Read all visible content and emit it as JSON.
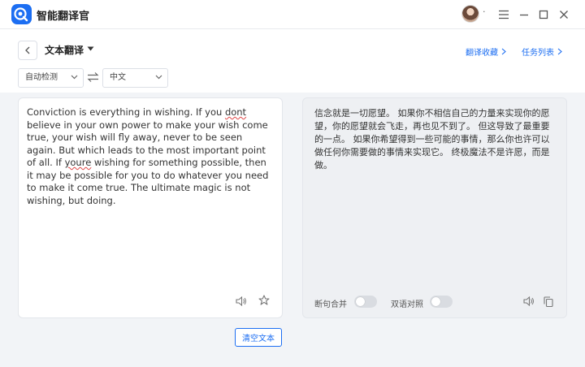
{
  "app": {
    "title": "智能翻译官"
  },
  "header": {
    "user_more": "·"
  },
  "toolbar": {
    "mode_label": "文本翻译",
    "favorites_link": "翻译收藏",
    "tasks_link": "任务列表",
    "source_language": "自动检测",
    "target_language": "中文"
  },
  "source": {
    "segments": [
      "Conviction is everything in wishing. If you ",
      "dont",
      " believe in your own power to make your wish come true, your wish will fly away, never to be seen again. But which leads to the most important point of all. If ",
      "youre",
      " wishing for something possible, then it may be possible for you to do whatever you need to make it come true. The ultimate magic is not wishing, but doing."
    ]
  },
  "result": {
    "text": "信念就是一切愿望。 如果你不相信自己的力量来实现你的愿望，你的愿望就会飞走，再也见不到了。 但这导致了最重要的一点。 如果你希望得到一些可能的事情，那么你也许可以做任何你需要做的事情来实现它。 终极魔法不是许愿，而是做。",
    "toggle_sentence_merge": "断句合并",
    "toggle_bilingual": "双语对照",
    "toggle_sentence_merge_on": false,
    "toggle_bilingual_on": false
  },
  "actions": {
    "clear_label": "清空文本"
  },
  "icons": {
    "logo": "app-logo-icon",
    "back": "chevron-left-icon",
    "caret": "caret-down-icon",
    "swap": "swap-arrows-icon",
    "speaker": "speaker-icon",
    "star": "star-icon",
    "copy": "copy-icon",
    "menu": "menu-icon",
    "minimize": "minimize-icon",
    "maximize": "maximize-icon",
    "close": "close-icon"
  },
  "colors": {
    "accent": "#1c6ef2",
    "spell_error": "#e04646"
  }
}
